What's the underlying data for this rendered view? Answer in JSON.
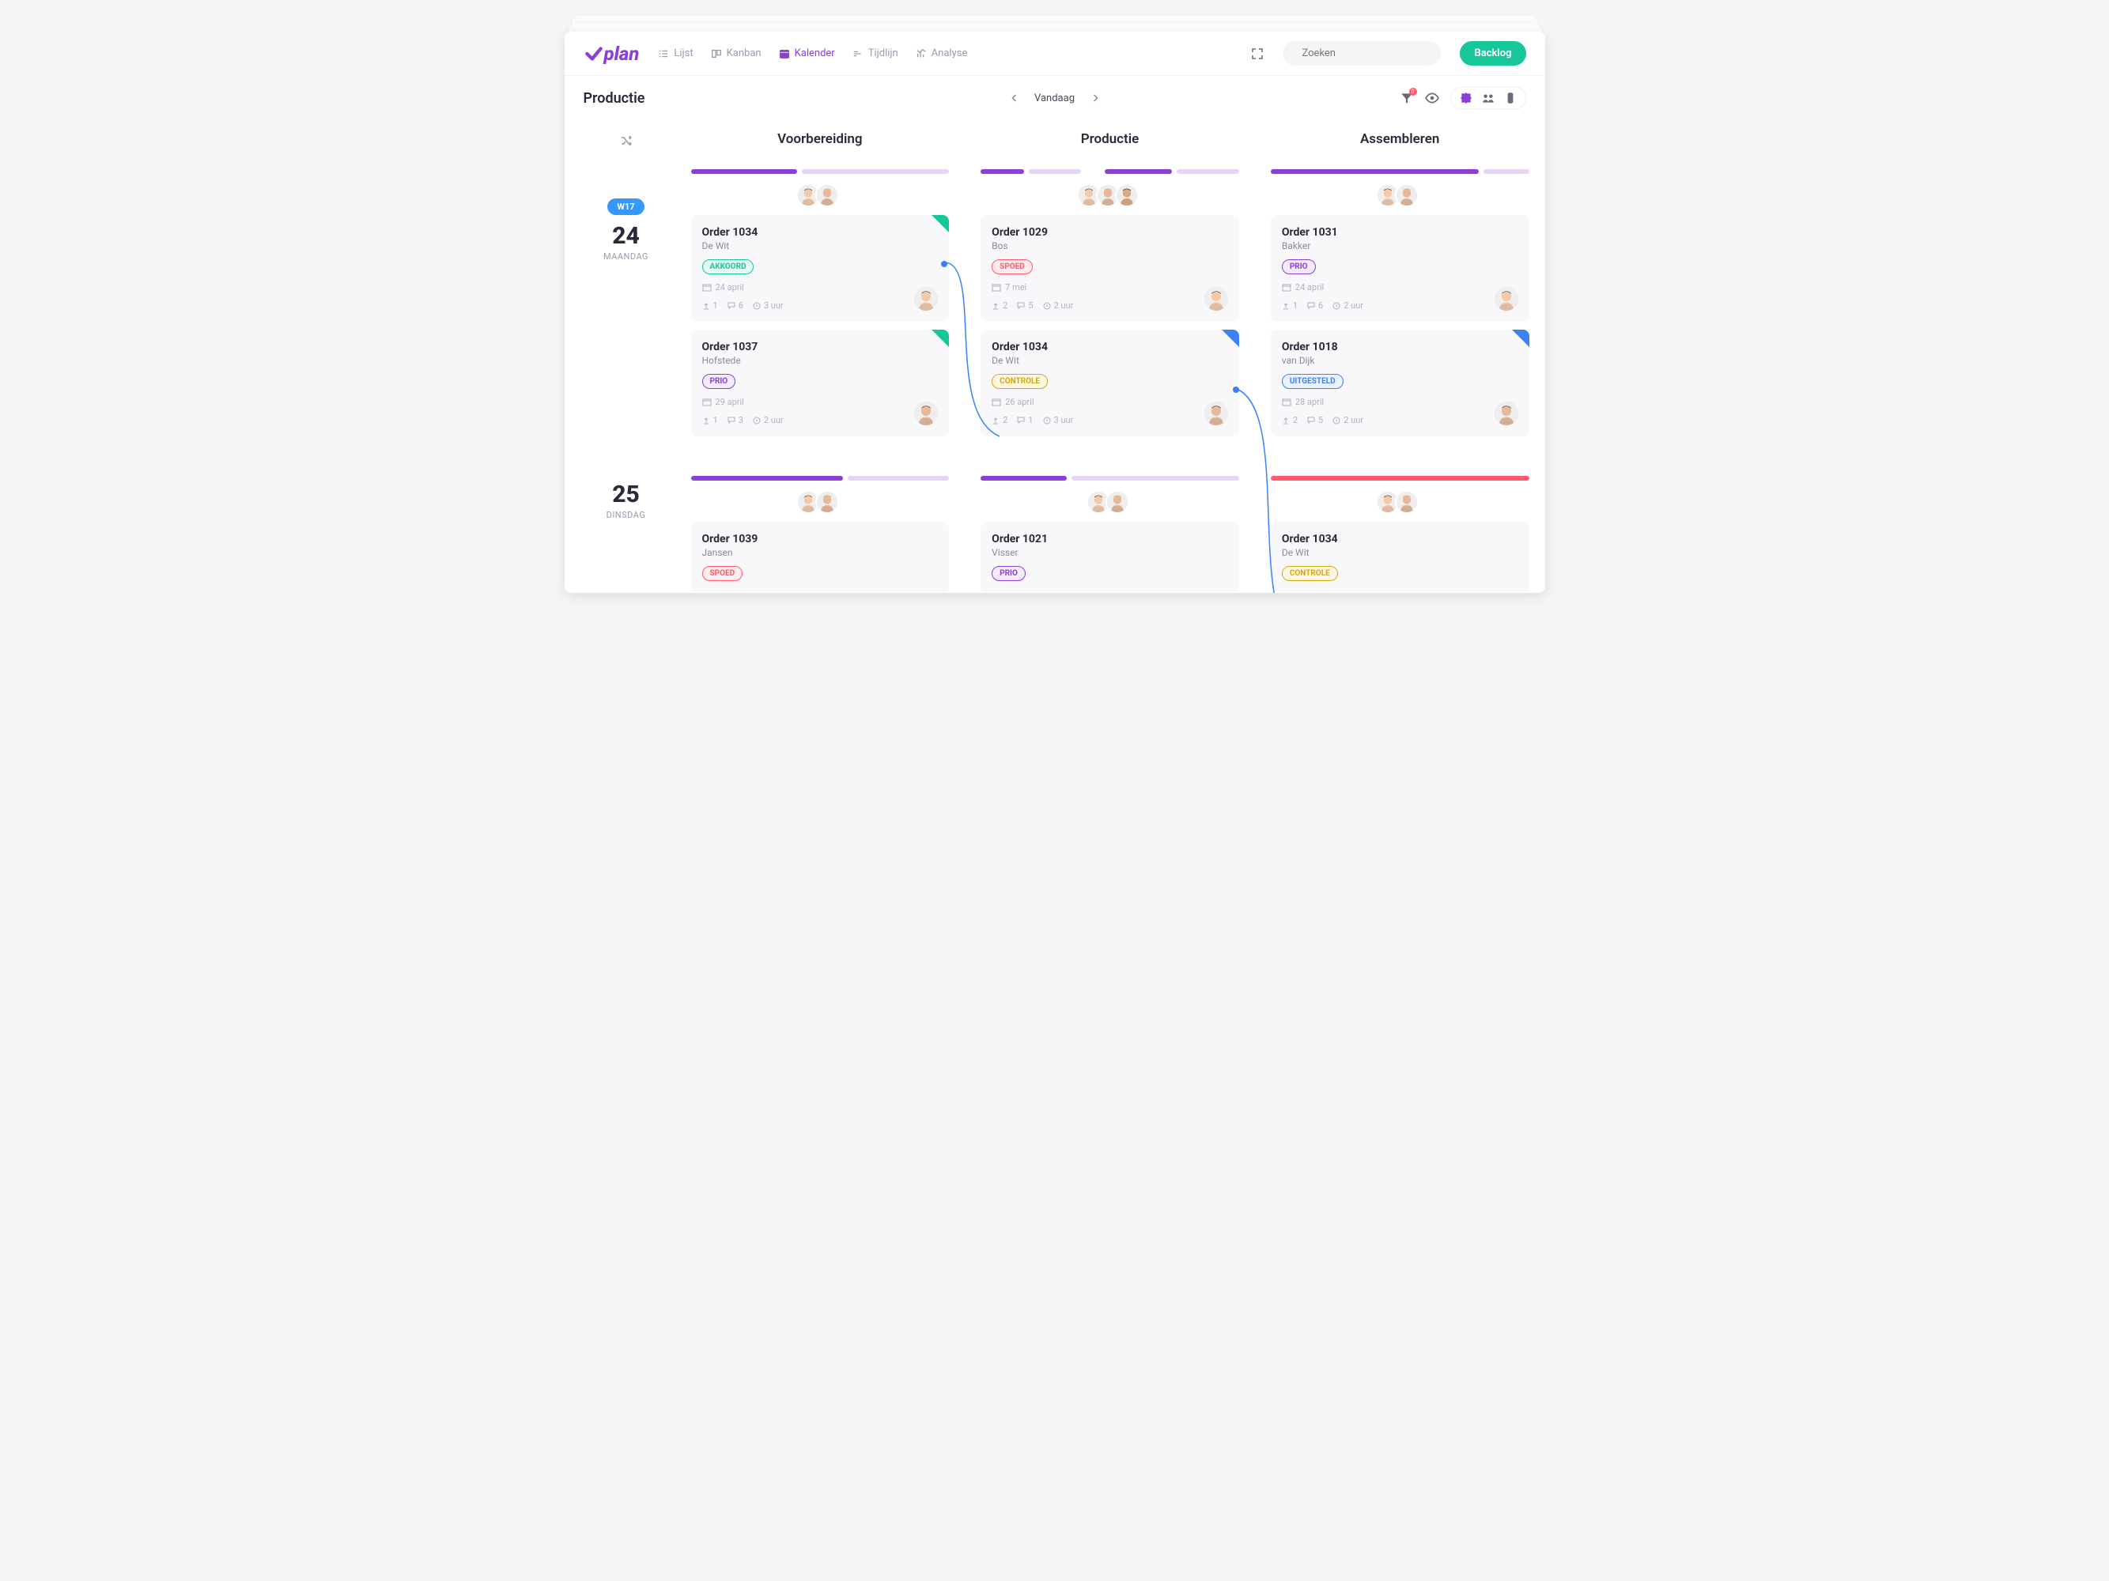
{
  "logo_text": "plan",
  "nav": [
    {
      "label": "Lijst",
      "active": false,
      "icon": "list"
    },
    {
      "label": "Kanban",
      "active": false,
      "icon": "kanban"
    },
    {
      "label": "Kalender",
      "active": true,
      "icon": "calendar"
    },
    {
      "label": "Tijdlijn",
      "active": false,
      "icon": "timeline"
    },
    {
      "label": "Analyse",
      "active": false,
      "icon": "chart"
    }
  ],
  "search_placeholder": "Zoeken",
  "backlog_label": "Backlog",
  "page_title": "Productie",
  "today_label": "Vandaag",
  "filter_badge": "0",
  "week_pill": "W17",
  "days": [
    {
      "num": "24",
      "name": "MAANDAG"
    },
    {
      "num": "25",
      "name": "DINSDAG"
    }
  ],
  "columns": [
    "Voorbereiding",
    "Productie",
    "Assembleren"
  ],
  "day1": {
    "col1": {
      "progress": [
        {
          "w": 42,
          "c": "#8b3fd6"
        },
        {
          "w": 58,
          "c": "#e6d5f7"
        }
      ],
      "avatars": 2,
      "cards": [
        {
          "title": "Order 1034",
          "sub": "De Wit",
          "tag": "AKKOORD",
          "tag_c": "#16c79a",
          "tag_bg": "#e8f9f3",
          "date": "24 april",
          "a": "1",
          "b": "6",
          "c": "3 uur",
          "corner": "#16c79a"
        },
        {
          "title": "Order 1037",
          "sub": "Hofstede",
          "tag": "PRIO",
          "tag_c": "#8b3fd6",
          "tag_bg": "#f3eafc",
          "date": "29 april",
          "a": "1",
          "b": "3",
          "c": "2 uur",
          "corner": "#16c79a"
        }
      ]
    },
    "col2": {
      "progress": [
        {
          "w": 18,
          "c": "#8b3fd6"
        },
        {
          "w": 22,
          "c": "#e6d5f7"
        },
        {
          "w": 6,
          "c": "transparent"
        },
        {
          "w": 28,
          "c": "#8b3fd6"
        },
        {
          "w": 26,
          "c": "#e6d5f7"
        }
      ],
      "avatars": 3,
      "cards": [
        {
          "title": "Order 1029",
          "sub": "Bos",
          "tag": "SPOED",
          "tag_c": "#ff5a6e",
          "tag_bg": "#ffecef",
          "date": "7 mei",
          "a": "2",
          "b": "5",
          "c": "2 uur",
          "corner": ""
        },
        {
          "title": "Order 1034",
          "sub": "De Wit",
          "tag": "CONTROLE",
          "tag_c": "#d4a914",
          "tag_bg": "#fdf6e0",
          "date": "26 april",
          "a": "2",
          "b": "1",
          "c": "3 uur",
          "corner": "#3b82f6"
        }
      ]
    },
    "col3": {
      "progress": [
        {
          "w": 82,
          "c": "#8b3fd6"
        },
        {
          "w": 18,
          "c": "#e6d5f7"
        }
      ],
      "avatars": 2,
      "cards": [
        {
          "title": "Order 1031",
          "sub": "Bakker",
          "tag": "PRIO",
          "tag_c": "#8b3fd6",
          "tag_bg": "#f3eafc",
          "date": "24 april",
          "a": "1",
          "b": "6",
          "c": "2 uur",
          "corner": ""
        },
        {
          "title": "Order 1018",
          "sub": "van Dijk",
          "tag": "UITGESTELD",
          "tag_c": "#3b82f6",
          "tag_bg": "#eaf2ff",
          "date": "28 april",
          "a": "2",
          "b": "5",
          "c": "2 uur",
          "corner": "#3b82f6"
        }
      ]
    }
  },
  "day2": {
    "col1": {
      "progress": [
        {
          "w": 60,
          "c": "#8b3fd6"
        },
        {
          "w": 40,
          "c": "#e6d5f7"
        }
      ],
      "avatars": 2,
      "cards": [
        {
          "title": "Order 1039",
          "sub": "Jansen",
          "tag": "SPOED",
          "tag_c": "#ff5a6e",
          "tag_bg": "#ffecef"
        }
      ]
    },
    "col2": {
      "progress": [
        {
          "w": 34,
          "c": "#8b3fd6"
        },
        {
          "w": 66,
          "c": "#e6d5f7"
        }
      ],
      "avatars": 2,
      "cards": [
        {
          "title": "Order 1021",
          "sub": "Visser",
          "tag": "PRIO",
          "tag_c": "#8b3fd6",
          "tag_bg": "#f3eafc"
        }
      ]
    },
    "col3": {
      "progress": [
        {
          "w": 100,
          "c": "#ff5a6e"
        }
      ],
      "avatars": 2,
      "cards": [
        {
          "title": "Order 1034",
          "sub": "De Wit",
          "tag": "CONTROLE",
          "tag_c": "#d4a914",
          "tag_bg": "#fdf6e0"
        }
      ]
    }
  }
}
